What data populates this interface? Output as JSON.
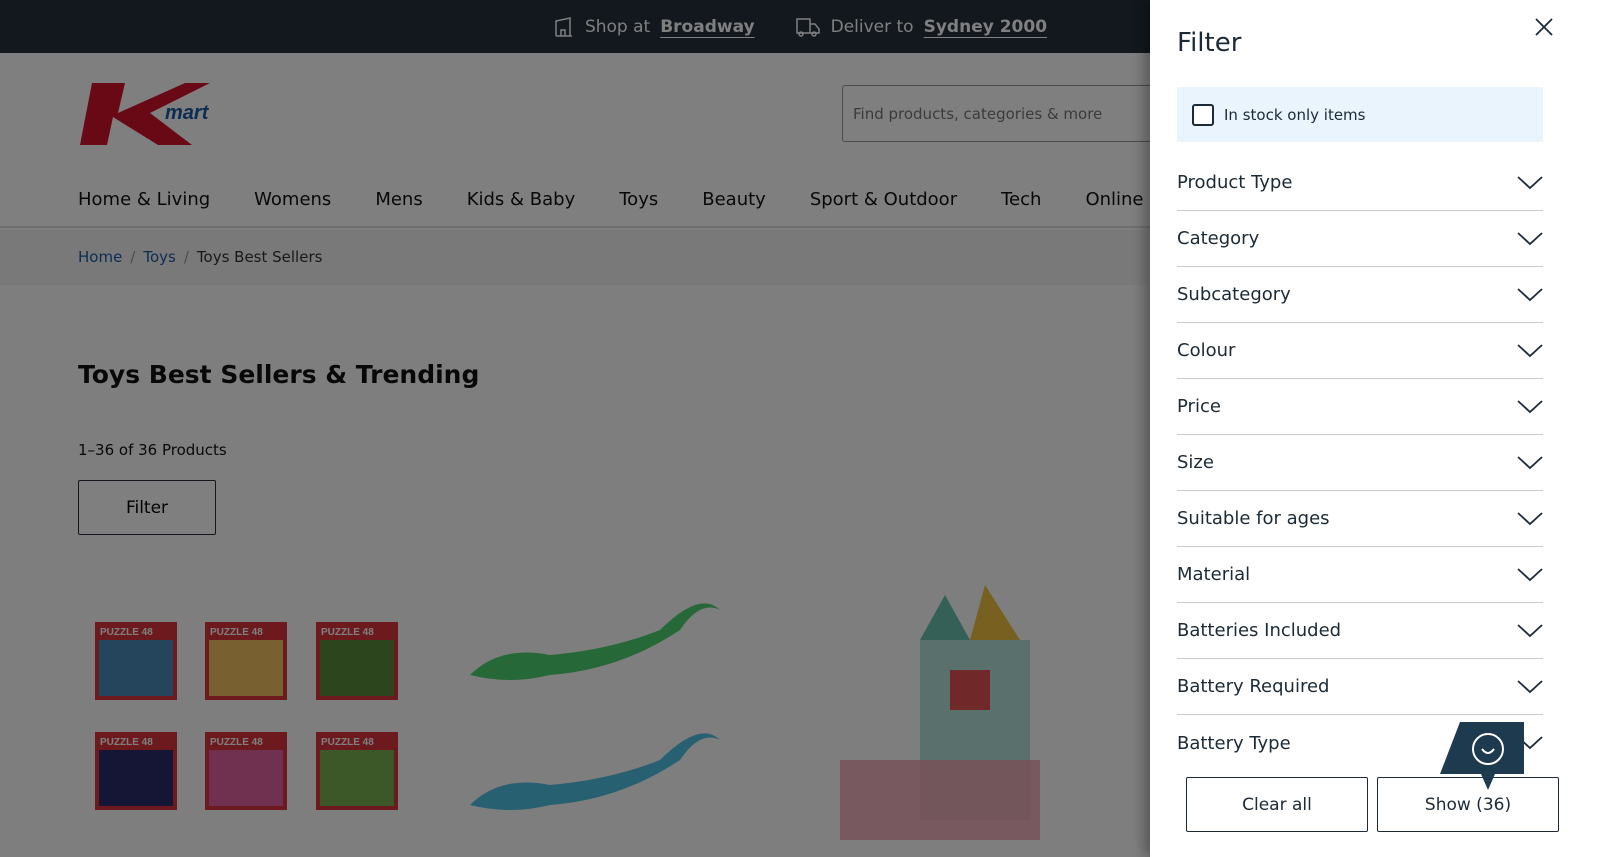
{
  "topbar": {
    "shop_prefix": "Shop at",
    "shop_store": "Broadway",
    "deliver_prefix": "Deliver to",
    "deliver_location": "Sydney 2000"
  },
  "header": {
    "logo_text": "Kmart",
    "search_placeholder": "Find products, categories & more",
    "nav": [
      "Home & Living",
      "Womens",
      "Mens",
      "Kids & Baby",
      "Toys",
      "Beauty",
      "Sport & Outdoor",
      "Tech",
      "Online Ex"
    ]
  },
  "breadcrumb": [
    "Home",
    "Toys",
    "Toys Best Sellers"
  ],
  "main": {
    "title": "Toys Best Sellers & Trending",
    "count": "1–36 of 36 Products",
    "filter_label": "Filter",
    "puzzle_label": "PUZZLE 48"
  },
  "filter_panel": {
    "title": "Filter",
    "in_stock_label": "In stock only items",
    "facets": [
      "Product Type",
      "Category",
      "Subcategory",
      "Colour",
      "Price",
      "Size",
      "Suitable for ages",
      "Material",
      "Batteries Included",
      "Battery Required",
      "Battery Type"
    ],
    "clear_label": "Clear all",
    "show_label": "Show (36)"
  },
  "colors": {
    "brand_red": "#c8102e",
    "brand_blue": "#1a5aa6",
    "dark": "#24313c",
    "feedback": "#1d3a4f"
  }
}
